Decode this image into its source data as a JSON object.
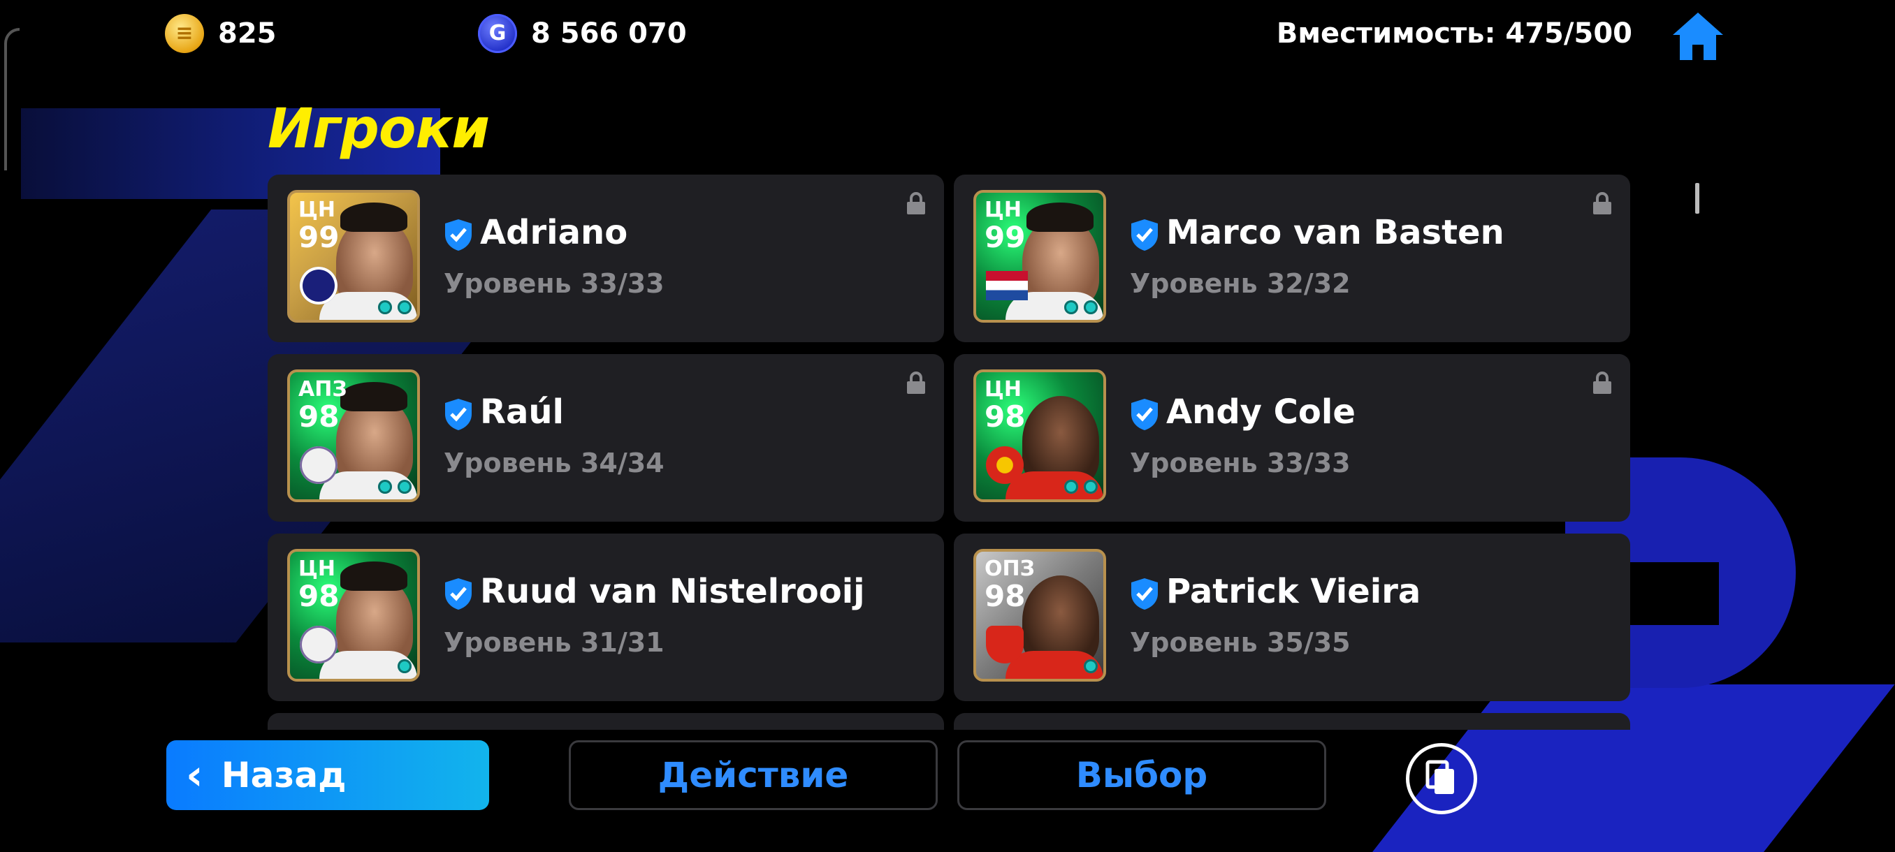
{
  "topbar": {
    "coins": "825",
    "gp": "8 566 070",
    "capacity": "Вместимость: 475/500"
  },
  "page_title": "Игроки",
  "players": [
    {
      "position": "ЦН",
      "rating": "99",
      "name": "Adriano",
      "level": "Уровень 33/33",
      "card_style": "gold",
      "club": "inter",
      "locked": true
    },
    {
      "position": "ЦН",
      "rating": "99",
      "name": "Marco van Basten",
      "level": "Уровень 32/32",
      "card_style": "green",
      "club": "netherlands-flag",
      "locked": true
    },
    {
      "position": "АПЗ",
      "rating": "98",
      "name": "Raúl",
      "level": "Уровень 34/34",
      "card_style": "green",
      "club": "real-madrid",
      "locked": true
    },
    {
      "position": "ЦН",
      "rating": "98",
      "name": "Andy Cole",
      "level": "Уровень 33/33",
      "card_style": "green",
      "club": "manchester-united",
      "locked": true
    },
    {
      "position": "ЦН",
      "rating": "98",
      "name": "Ruud van Nistelrooij",
      "level": "Уровень 31/31",
      "card_style": "green",
      "club": "real-madrid",
      "locked": false
    },
    {
      "position": "ОПЗ",
      "rating": "98",
      "name": "Patrick Vieira",
      "level": "Уровень 35/35",
      "card_style": "green",
      "club": "arsenal",
      "locked": false
    }
  ],
  "buttons": {
    "back": "Назад",
    "action": "Действие",
    "select": "Выбор"
  },
  "colors": {
    "accent_blue": "#2f8cff",
    "title_yellow": "#ffee00",
    "card_bg": "#1f1f23"
  }
}
